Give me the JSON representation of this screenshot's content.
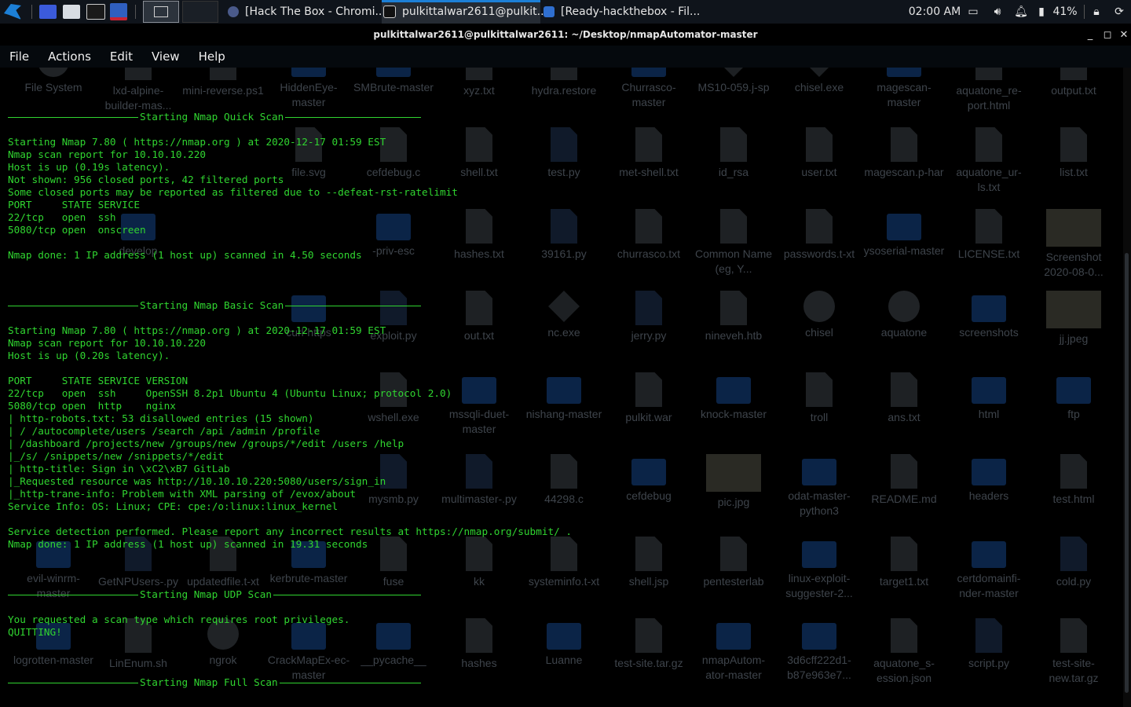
{
  "panel": {
    "tasks": [
      {
        "label": "[Hack The Box - Chromi..."
      },
      {
        "label": "pulkittalwar2611@pulkit..."
      },
      {
        "label": "[Ready-hackthebox - Fil..."
      }
    ],
    "time": "02:00 AM",
    "battery": "41%"
  },
  "window": {
    "title": "pulkittalwar2611@pulkittalwar2611: ~/Desktop/nmapAutomator-master",
    "minimize": "_",
    "maximize": "◻",
    "close": "✕"
  },
  "menu": [
    "File",
    "Actions",
    "Edit",
    "View",
    "Help"
  ],
  "desktop_icons": [
    {
      "label": "File System"
    },
    {
      "label": "lxd-alpine-builder-mas..."
    },
    {
      "label": "mini-reverse.ps1"
    },
    {
      "label": "HiddenEye-master"
    },
    {
      "label": "SMBrute-master"
    },
    {
      "label": "xyz.txt"
    },
    {
      "label": "hydra.restore"
    },
    {
      "label": "Churrasco-master"
    },
    {
      "label": "MS10-059.j-sp"
    },
    {
      "label": "chisel.exe"
    },
    {
      "label": "magescan-master"
    },
    {
      "label": "aquatone_re-port.html"
    },
    {
      "label": "output.txt"
    },
    {
      "label": "file.svg"
    },
    {
      "label": "cefdebug.c"
    },
    {
      "label": "shell.txt"
    },
    {
      "label": "test.py"
    },
    {
      "label": "met-shell.txt"
    },
    {
      "label": "id_rsa"
    },
    {
      "label": "user.txt"
    },
    {
      "label": "magescan.p-har"
    },
    {
      "label": "aquatone_ur-ls.txt"
    },
    {
      "label": "list.txt"
    },
    {
      "label": "-priv-esc"
    },
    {
      "label": "hashes.txt"
    },
    {
      "label": "39161.py"
    },
    {
      "label": "churrasco.txt"
    },
    {
      "label": "Common Name (eg, Y..."
    },
    {
      "label": "passwords.t-xt"
    },
    {
      "label": "ysoserial-master"
    },
    {
      "label": "LICENSE.txt"
    },
    {
      "label": "Screenshot 2020-08-0..."
    },
    {
      "label": "out.txt"
    },
    {
      "label": "nc.exe"
    },
    {
      "label": "jerry.py"
    },
    {
      "label": "nineveh.htb"
    },
    {
      "label": "chisel"
    },
    {
      "label": "aquatone"
    },
    {
      "label": "screenshots"
    },
    {
      "label": "jj.jpeg"
    },
    {
      "label": "wshell.exe"
    },
    {
      "label": "mssqli-duet-master"
    },
    {
      "label": "nishang-master"
    },
    {
      "label": "pulkit.war"
    },
    {
      "label": "knock-master"
    },
    {
      "label": "troll"
    },
    {
      "label": "ans.txt"
    },
    {
      "label": "html"
    },
    {
      "label": "ftp"
    },
    {
      "label": "mysmb.py"
    },
    {
      "label": "multimaster-.py"
    },
    {
      "label": "44298.c"
    },
    {
      "label": "cefdebug"
    },
    {
      "label": "pic.jpg"
    },
    {
      "label": "odat-master-python3"
    },
    {
      "label": "README.md"
    },
    {
      "label": "headers"
    },
    {
      "label": "test.html"
    },
    {
      "label": "evil-winrm-master"
    },
    {
      "label": "GetNPUsers-.py"
    },
    {
      "label": "updatedfile.t-xt"
    },
    {
      "label": "kerbrute-master"
    },
    {
      "label": "fuse"
    },
    {
      "label": "kk"
    },
    {
      "label": "systeminfo.t-xt"
    },
    {
      "label": "shell.jsp"
    },
    {
      "label": "pentesterlab"
    },
    {
      "label": "linux-exploit-suggester-2..."
    },
    {
      "label": "target1.txt"
    },
    {
      "label": "certdomainfi-nder-master"
    },
    {
      "label": "cold.py"
    },
    {
      "label": "logrotten-master"
    },
    {
      "label": "LinEnum.sh"
    },
    {
      "label": "ngrok"
    },
    {
      "label": "CrackMapEx-ec-master"
    },
    {
      "label": "__pycache__"
    },
    {
      "label": "hashes"
    },
    {
      "label": "Luanne"
    },
    {
      "label": "test-site.tar.gz"
    },
    {
      "label": "nmapAutom-ator-master"
    },
    {
      "label": "3d6cff222d1-b87e963e7..."
    },
    {
      "label": "aquatone_s-ession.json"
    },
    {
      "label": "script.py"
    },
    {
      "label": "test-site-new.tar.gz"
    },
    {
      "label": "develop"
    },
    {
      "label": "curl-https"
    },
    {
      "label": "exploit.py"
    }
  ],
  "terminal": {
    "headers": [
      "Starting Nmap Quick Scan",
      "Starting Nmap Basic Scan",
      "Starting Nmap UDP Scan",
      "Starting Nmap Full Scan"
    ],
    "quick": [
      "Starting Nmap 7.80 ( https://nmap.org ) at 2020-12-17 01:59 EST",
      "Nmap scan report for 10.10.10.220",
      "Host is up (0.19s latency).",
      "Not shown: 956 closed ports, 42 filtered ports",
      "Some closed ports may be reported as filtered due to --defeat-rst-ratelimit",
      "PORT     STATE SERVICE",
      "22/tcp   open  ssh",
      "5080/tcp open  onscreen",
      "",
      "Nmap done: 1 IP address (1 host up) scanned in 4.50 seconds"
    ],
    "basic": [
      "Starting Nmap 7.80 ( https://nmap.org ) at 2020-12-17 01:59 EST",
      "Nmap scan report for 10.10.10.220",
      "Host is up (0.20s latency).",
      "",
      "PORT     STATE SERVICE VERSION",
      "22/tcp   open  ssh     OpenSSH 8.2p1 Ubuntu 4 (Ubuntu Linux; protocol 2.0)",
      "5080/tcp open  http    nginx",
      "| http-robots.txt: 53 disallowed entries (15 shown)",
      "| / /autocomplete/users /search /api /admin /profile",
      "| /dashboard /projects/new /groups/new /groups/*/edit /users /help",
      "|_/s/ /snippets/new /snippets/*/edit",
      "| http-title: Sign in \\xC2\\xB7 GitLab",
      "|_Requested resource was http://10.10.10.220:5080/users/sign_in",
      "|_http-trane-info: Problem with XML parsing of /evox/about",
      "Service Info: OS: Linux; CPE: cpe:/o:linux:linux_kernel",
      "",
      "Service detection performed. Please report any incorrect results at https://nmap.org/submit/ .",
      "Nmap done: 1 IP address (1 host up) scanned in 19.31 seconds"
    ],
    "udp": [
      "You requested a scan type which requires root privileges.",
      "QUITTING!"
    ]
  }
}
